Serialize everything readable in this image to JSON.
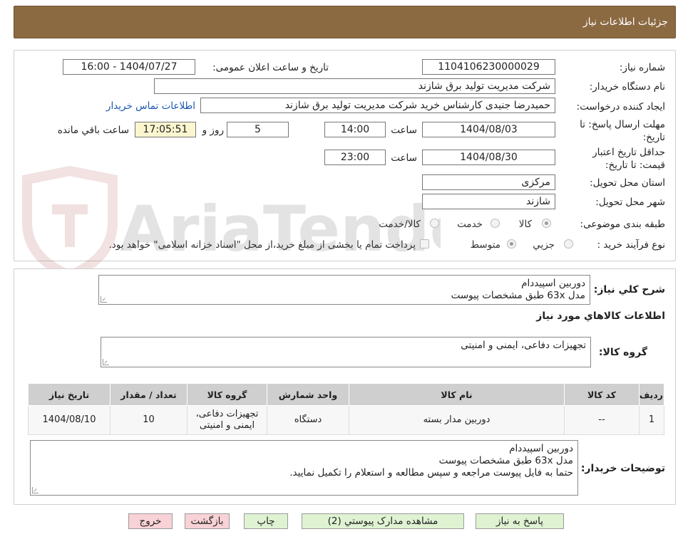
{
  "header": {
    "title": "جزئیات اطلاعات نیاز"
  },
  "fields": {
    "need_number_label": "شماره نیاز:",
    "need_number": "1104106230000029",
    "announce_label": "تاریخ و ساعت اعلان عمومی:",
    "announce_value": "1404/07/27 - 16:00",
    "buyer_org_label": "نام دستگاه خریدار:",
    "buyer_org": "شرکت مدیریت تولید برق شازند",
    "requester_label": "ایجاد کننده درخواست:",
    "requester": "حمیدرضا جنیدی کارشناس خرید شرکت مدیریت تولید برق شازند",
    "buyer_contact_link": "اطلاعات تماس خریدار",
    "deadline_label": "مهلت ارسال پاسخ: تا تاریخ:",
    "deadline_date": "1404/08/03",
    "time_label": "ساعت",
    "deadline_time": "14:00",
    "days_value": "5",
    "days_label": "روز و",
    "remaining_time": "17:05:51",
    "remaining_label": "ساعت باقي مانده",
    "validity_label": "حداقل تاریخ اعتبار قیمت: تا تاریخ:",
    "validity_date": "1404/08/30",
    "validity_time": "23:00",
    "province_label": "استان محل تحویل:",
    "province": "مرکزی",
    "city_label": "شهر محل تحویل:",
    "city": "شازند",
    "category_label": "طبقه بندی موضوعی:",
    "category_options": [
      "کالا",
      "خدمت",
      "کالا/خدمت"
    ],
    "process_label": "نوع فرآیند خرید :",
    "process_options": [
      "جزیي",
      "متوسط"
    ],
    "payment_note": "پرداخت تمام یا بخشی از مبلغ خرید،از محل \"اسناد خزانه اسلامی\" خواهد بود."
  },
  "summary": {
    "general_desc_label": "شرح کلي نياز:",
    "general_desc_lines": [
      "دوربین اسپیددام",
      "مدل 63x طبق مشخصات پیوست"
    ],
    "goods_info_title": "اطلاعات کالاهاي مورد نياز",
    "goods_group_label": "گروه کالا:",
    "goods_group": "تجهیزات دفاعی، ایمنی و امنیتی"
  },
  "table": {
    "headers": [
      "رديف",
      "کد کالا",
      "نام کالا",
      "واحد شمارش",
      "گروه کالا",
      "تعداد / مقدار",
      "تاريخ نياز"
    ],
    "rows": [
      [
        "1",
        "--",
        "دوربین مدار بسته",
        "دستگاه",
        "تجهیزات دفاعی، ایمنی و امنیتی",
        "10",
        "1404/08/10"
      ]
    ]
  },
  "buyer_notes": {
    "label": "توضیحات خریدار:",
    "lines": [
      "دوربین اسپیددام",
      "مدل 63x طبق مشخصات پیوست",
      "حتما به فایل پیوست مراجعه و سپس مطالعه و استعلام را تکمیل نمایید."
    ]
  },
  "buttons": {
    "reply": "پاسخ به نیاز",
    "attachments": "مشاهده مدارک پیوستي (2)",
    "print": "چاپ",
    "back": "بازگشت",
    "exit": "خروج"
  },
  "watermark": {
    "text": "AriaTender.net"
  },
  "colors": {
    "header_bg": "#8b6a42",
    "link": "#1a56b0",
    "time_box": "#fbf6cf",
    "green_button": "#dff3d3",
    "pink_button": "#f8d2d6"
  }
}
